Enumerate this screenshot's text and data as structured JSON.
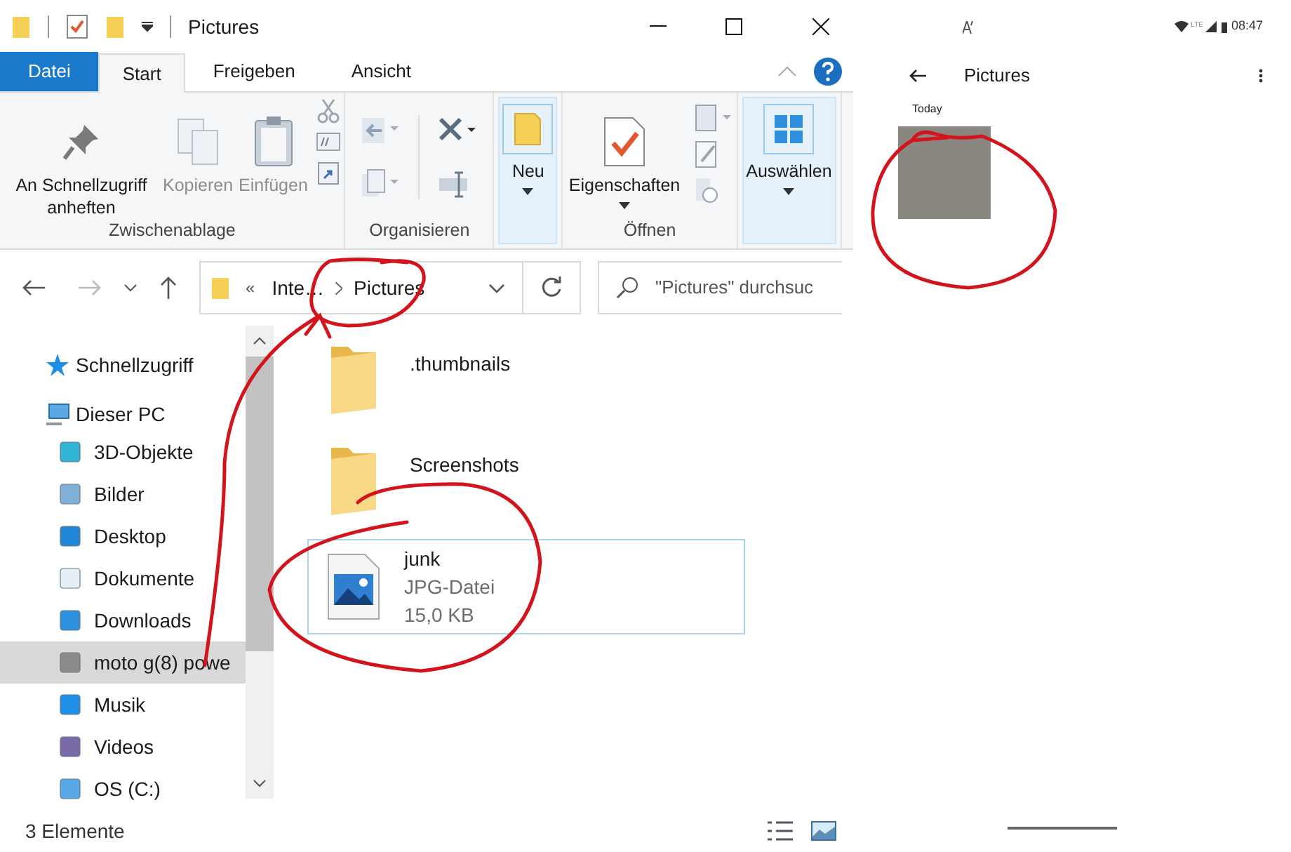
{
  "explorer": {
    "title": "Pictures",
    "ribbon_tabs": [
      {
        "label": "Datei",
        "kind": "file",
        "selected": false
      },
      {
        "label": "Start",
        "kind": "tab",
        "selected": true
      },
      {
        "label": "Freigeben",
        "kind": "tab",
        "selected": false
      },
      {
        "label": "Ansicht",
        "kind": "tab",
        "selected": false
      }
    ],
    "ribbon_groups": [
      {
        "name": "Zwischenablage",
        "buttons": [
          {
            "label": "An Schnellzugriff anheften",
            "disabled": false,
            "highlighted": false,
            "dropdown": false
          },
          {
            "label": "Kopieren",
            "disabled": true,
            "highlighted": false,
            "dropdown": false
          },
          {
            "label": "Einfügen",
            "disabled": true,
            "highlighted": false,
            "dropdown": false
          }
        ]
      },
      {
        "name": "Organisieren"
      },
      {
        "buttons": [
          {
            "label": "Neu",
            "disabled": false,
            "highlighted": true,
            "dropdown": true
          }
        ]
      },
      {
        "name": "Öffnen",
        "buttons": [
          {
            "label": "Eigenschaften",
            "disabled": false,
            "highlighted": false,
            "dropdown": true
          }
        ]
      },
      {
        "buttons": [
          {
            "label": "Auswählen",
            "disabled": false,
            "highlighted": true,
            "dropdown": true
          }
        ]
      }
    ],
    "address": {
      "overflow": "«",
      "crumbs": [
        "Inte…",
        "Pictures"
      ]
    },
    "search": {
      "placeholder": "\"Pictures\" durchsuc"
    },
    "nav": [
      {
        "label": "Schnellzugriff",
        "selected": false
      },
      {
        "label": "Dieser PC",
        "selected": false,
        "children": [
          {
            "label": "3D-Objekte",
            "selected": false
          },
          {
            "label": "Bilder",
            "selected": false
          },
          {
            "label": "Desktop",
            "selected": false
          },
          {
            "label": "Dokumente",
            "selected": false
          },
          {
            "label": "Downloads",
            "selected": false
          },
          {
            "label": "moto g(8) powe",
            "selected": true
          },
          {
            "label": "Musik",
            "selected": false
          },
          {
            "label": "Videos",
            "selected": false
          },
          {
            "label": "OS (C:)",
            "selected": false
          }
        ]
      }
    ],
    "items": [
      {
        "kind": "folder",
        "name": ".thumbnails",
        "selected": false
      },
      {
        "kind": "folder",
        "name": "Screenshots",
        "selected": false
      },
      {
        "kind": "file",
        "name": "junk",
        "type": "JPG-Datei",
        "size": "15,0 KB",
        "selected": true
      }
    ],
    "status": "3 Elemente"
  },
  "phone": {
    "status_time": "08:47",
    "network": "LTE",
    "title": "Pictures",
    "section": "Today"
  }
}
